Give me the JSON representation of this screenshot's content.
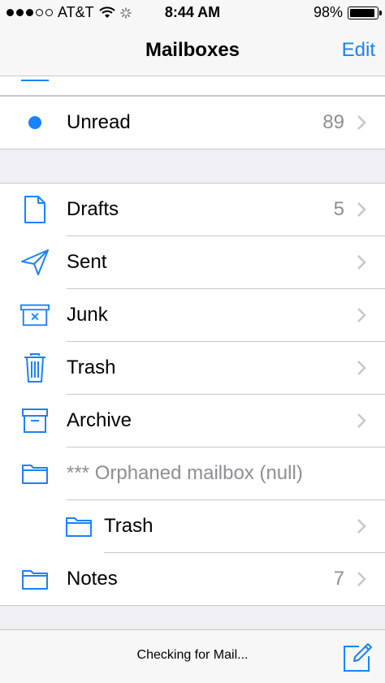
{
  "status_bar": {
    "carrier": "AT&T",
    "time": "8:44 AM",
    "battery": "98%",
    "battery_level": 0.98,
    "signal_bars_filled": 3,
    "signal_bars_total": 5
  },
  "nav": {
    "title": "Mailboxes",
    "edit_label": "Edit"
  },
  "top_group": {
    "unread": {
      "label": "Unread",
      "count": "89"
    }
  },
  "mailboxes": [
    {
      "label": "Drafts",
      "count": "5",
      "icon": "document-icon"
    },
    {
      "label": "Sent",
      "count": "",
      "icon": "paper-plane-icon"
    },
    {
      "label": "Junk",
      "count": "",
      "icon": "junk-bin-icon"
    },
    {
      "label": "Trash",
      "count": "",
      "icon": "trash-icon"
    },
    {
      "label": "Archive",
      "count": "",
      "icon": "archive-box-icon"
    },
    {
      "label": "*** Orphaned mailbox (null)",
      "count": "",
      "icon": "folder-icon"
    },
    {
      "label": "Trash",
      "count": "",
      "icon": "folder-icon"
    },
    {
      "label": "Notes",
      "count": "7",
      "icon": "folder-icon"
    }
  ],
  "toolbar": {
    "status": "Checking for Mail..."
  },
  "colors": {
    "accent": "#1a82fb",
    "separator": "#c8c7cc",
    "muted": "#8e8e93"
  }
}
